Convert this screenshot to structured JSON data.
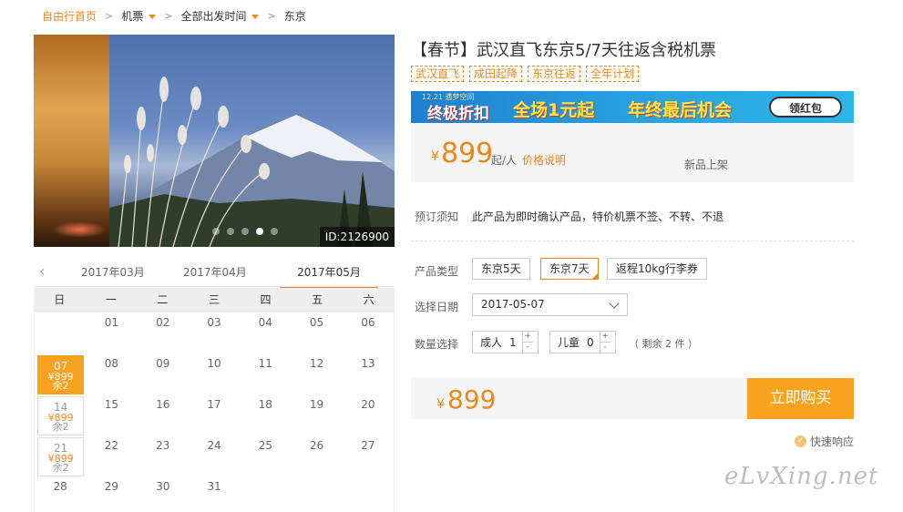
{
  "breadcrumb": {
    "home": "自由行首页",
    "items": [
      "机票",
      "全部出发时间",
      "东京"
    ]
  },
  "gallery": {
    "id_label": "ID:2126900",
    "dot_count": 5,
    "active_dot": 4
  },
  "calendar": {
    "months": [
      "2017年03月",
      "2017年04月",
      "2017年05月"
    ],
    "active_month": "2017年05月",
    "weekdays": [
      "日",
      "一",
      "二",
      "三",
      "四",
      "五",
      "六"
    ],
    "days": [
      {
        "num": ""
      },
      {
        "num": "01"
      },
      {
        "num": "02"
      },
      {
        "num": "03"
      },
      {
        "num": "04"
      },
      {
        "num": "05"
      },
      {
        "num": "06"
      },
      {
        "num": "07",
        "price": "¥899",
        "left": "余2",
        "state": "sel"
      },
      {
        "num": "08"
      },
      {
        "num": "09"
      },
      {
        "num": "10"
      },
      {
        "num": "11"
      },
      {
        "num": "12"
      },
      {
        "num": "13"
      },
      {
        "num": "14",
        "price": "¥899",
        "left": "余2",
        "state": "avail"
      },
      {
        "num": "15"
      },
      {
        "num": "16"
      },
      {
        "num": "17"
      },
      {
        "num": "18"
      },
      {
        "num": "19"
      },
      {
        "num": "20"
      },
      {
        "num": "21",
        "price": "¥899",
        "left": "余2",
        "state": "avail"
      },
      {
        "num": "22"
      },
      {
        "num": "23"
      },
      {
        "num": "24"
      },
      {
        "num": "25"
      },
      {
        "num": "26"
      },
      {
        "num": "27"
      },
      {
        "num": "28"
      },
      {
        "num": "29"
      },
      {
        "num": "30"
      },
      {
        "num": "31"
      }
    ]
  },
  "product": {
    "title": "【春节】武汉直飞东京5/7天往返含税机票",
    "tags": [
      "武汉直飞",
      "成田起降",
      "东京往返",
      "全年计划"
    ]
  },
  "banner": {
    "small": "12.21 遇梦空间",
    "line1": "终极折扣",
    "line2": "全场1元起",
    "line3": "年终最后机会",
    "cta": "领红包"
  },
  "price": {
    "currency": "¥",
    "amount": "899",
    "per": "起/人",
    "explain": "价格说明",
    "badge": "新品上架"
  },
  "notice": {
    "label": "预订须知",
    "text": "此产品为即时确认产品，特价机票不签、不转、不退"
  },
  "options": {
    "type_label": "产品类型",
    "types": [
      "东京5天",
      "东京7天",
      "返程10kg行李券"
    ],
    "selected_type": "东京7天",
    "date_label": "选择日期",
    "date_value": "2017-05-07",
    "qty_label": "数量选择",
    "adult_label": "成人",
    "adult_value": "1",
    "child_label": "儿童",
    "child_value": "0",
    "remain": "（ 剩余 2 件 ）"
  },
  "buy": {
    "currency": "¥",
    "amount": "899",
    "button": "立即购买"
  },
  "fast_response": "快速响应",
  "watermark": "eLvXing.net",
  "colors": {
    "accent": "#f08519",
    "buy_button": "#f8a21f"
  }
}
